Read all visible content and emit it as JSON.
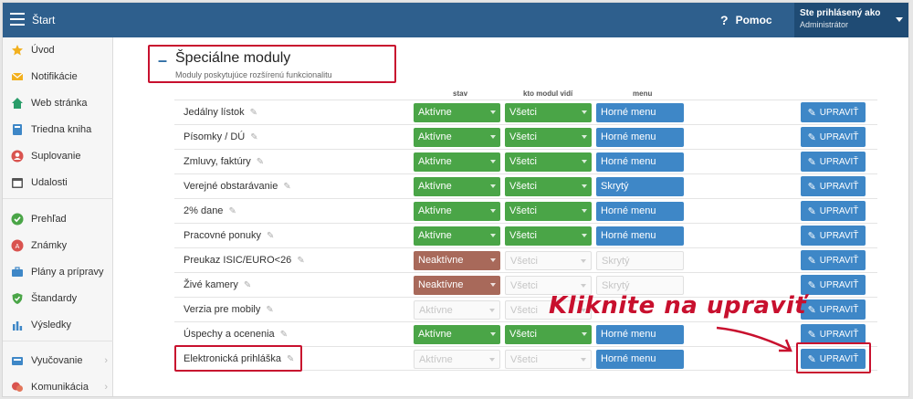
{
  "topbar": {
    "title": "Štart",
    "help_label": "Pomoc",
    "user_line1": "Ste prihlásený ako",
    "user_line2": "Administrátor"
  },
  "sidebar": {
    "items": [
      {
        "label": "Úvod",
        "icon": "star-icon"
      },
      {
        "label": "Notifikácie",
        "icon": "envelope-icon"
      },
      {
        "label": "Web stránka",
        "icon": "home-icon"
      },
      {
        "label": "Triedna kniha",
        "icon": "book-icon"
      },
      {
        "label": "Suplovanie",
        "icon": "person-icon"
      },
      {
        "label": "Udalosti",
        "icon": "calendar-icon"
      },
      {
        "label": "Prehľad",
        "icon": "check-circle-icon"
      },
      {
        "label": "Známky",
        "icon": "grade-icon"
      },
      {
        "label": "Plány a prípravy",
        "icon": "briefcase-icon"
      },
      {
        "label": "Štandardy",
        "icon": "shield-check-icon"
      },
      {
        "label": "Výsledky",
        "icon": "bar-chart-icon"
      },
      {
        "label": "Vyučovanie",
        "icon": "classroom-icon"
      },
      {
        "label": "Komunikácia",
        "icon": "chat-icon"
      }
    ],
    "chevron": "›"
  },
  "section": {
    "dash": "–",
    "title": "Špeciálne moduly",
    "subtitle": "Moduly poskytujúce rozšírenú funkcionalitu"
  },
  "columns": {
    "stav": "stav",
    "kto": "kto modul vidí",
    "menu": "menu"
  },
  "edit_label": "UPRAVIŤ",
  "rows": [
    {
      "name": "Jedálny lístok",
      "stav": "Aktívne",
      "kto": "Všetci",
      "menu": "Horné menu"
    },
    {
      "name": "Písomky / DÚ",
      "stav": "Aktívne",
      "kto": "Všetci",
      "menu": "Horné menu"
    },
    {
      "name": "Zmluvy, faktúry",
      "stav": "Aktívne",
      "kto": "Všetci",
      "menu": "Horné menu"
    },
    {
      "name": "Verejné obstarávanie",
      "stav": "Aktívne",
      "kto": "Všetci",
      "menu": "Skrytý"
    },
    {
      "name": "2% dane",
      "stav": "Aktívne",
      "kto": "Všetci",
      "menu": "Horné menu"
    },
    {
      "name": "Pracovné ponuky",
      "stav": "Aktívne",
      "kto": "Všetci",
      "menu": "Horné menu"
    },
    {
      "name": "Preukaz ISIC/EURO<26",
      "stav": "Neaktívne",
      "kto": "Všetci",
      "menu": "Skrytý"
    },
    {
      "name": "Živé kamery",
      "stav": "Neaktívne",
      "kto": "Všetci",
      "menu": "Skrytý"
    },
    {
      "name": "Verzia pre mobily",
      "stav": "Aktívne",
      "kto": "Všetci",
      "menu": ""
    },
    {
      "name": "Úspechy a ocenenia",
      "stav": "Aktívne",
      "kto": "Všetci",
      "menu": "Horné menu"
    },
    {
      "name": "Elektronická prihláška",
      "stav": "Aktívne",
      "kto": "Všetci",
      "menu": "Horné menu"
    }
  ],
  "annotation": "Kliknite na upraviť",
  "colors": {
    "topbar": "#2e5f8d",
    "active_green": "#4aa547",
    "inactive_brown": "#a8695a",
    "blue": "#3e87c7",
    "highlight_red": "#c8102e"
  }
}
